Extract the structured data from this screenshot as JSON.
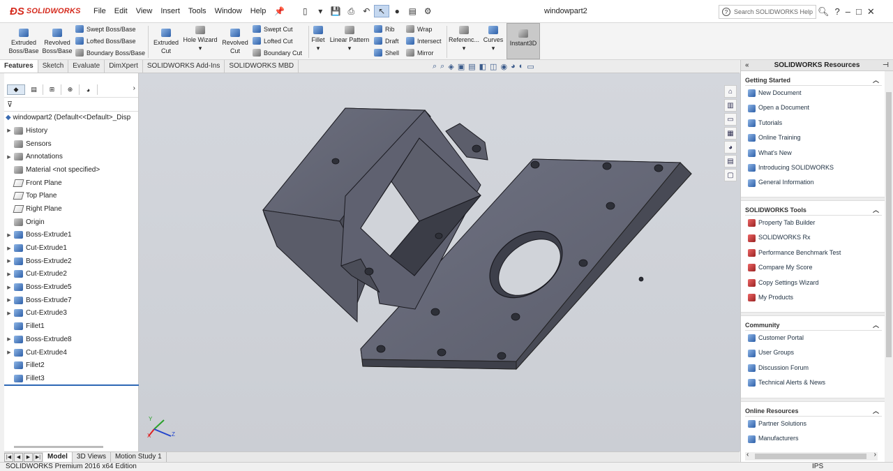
{
  "app": {
    "brand": "SOLIDWORKS",
    "doc_title": "windowpart2"
  },
  "menu": [
    "File",
    "Edit",
    "View",
    "Insert",
    "Tools",
    "Window",
    "Help"
  ],
  "help_search": {
    "placeholder": "Search SOLIDWORKS Help"
  },
  "commands": {
    "extruded_boss": [
      "Extruded",
      "Boss/Base"
    ],
    "revolved_boss": [
      "Revolved",
      "Boss/Base"
    ],
    "swept_boss": "Swept Boss/Base",
    "lofted_boss": "Lofted Boss/Base",
    "boundary_boss": "Boundary Boss/Base",
    "extruded_cut": [
      "Extruded",
      "Cut"
    ],
    "hole_wizard": "Hole Wizard",
    "revolved_cut": [
      "Revolved",
      "Cut"
    ],
    "swept_cut": "Swept Cut",
    "lofted_cut": "Lofted Cut",
    "boundary_cut": "Boundary Cut",
    "fillet": "Fillet",
    "linear_pattern": "Linear Pattern",
    "rib": "Rib",
    "draft": "Draft",
    "shell": "Shell",
    "wrap": "Wrap",
    "intersect": "Intersect",
    "mirror": "Mirror",
    "reference": "Referenc...",
    "curves": "Curves",
    "instant3d": "Instant3D"
  },
  "tabs": [
    "Features",
    "Sketch",
    "Evaluate",
    "DimXpert",
    "SOLIDWORKS Add-Ins",
    "SOLIDWORKS MBD"
  ],
  "tree": {
    "root": "windowpart2  (Default<<Default>_Disp",
    "items": [
      {
        "label": "History",
        "expand": true,
        "icon": "history-icon"
      },
      {
        "label": "Sensors",
        "expand": false,
        "icon": "sensors-icon"
      },
      {
        "label": "Annotations",
        "expand": true,
        "icon": "annotations-icon"
      },
      {
        "label": "Material <not specified>",
        "expand": false,
        "icon": "material-icon"
      },
      {
        "label": "Front Plane",
        "expand": false,
        "icon": "plane-icon"
      },
      {
        "label": "Top Plane",
        "expand": false,
        "icon": "plane-icon"
      },
      {
        "label": "Right Plane",
        "expand": false,
        "icon": "plane-icon"
      },
      {
        "label": "Origin",
        "expand": false,
        "icon": "origin-icon"
      },
      {
        "label": "Boss-Extrude1",
        "expand": true,
        "icon": "boss-extrude-icon"
      },
      {
        "label": "Cut-Extrude1",
        "expand": true,
        "icon": "cut-extrude-icon"
      },
      {
        "label": "Boss-Extrude2",
        "expand": true,
        "icon": "boss-extrude-icon"
      },
      {
        "label": "Cut-Extrude2",
        "expand": true,
        "icon": "cut-extrude-icon"
      },
      {
        "label": "Boss-Extrude5",
        "expand": true,
        "icon": "boss-extrude-icon"
      },
      {
        "label": "Boss-Extrude7",
        "expand": true,
        "icon": "boss-extrude-icon"
      },
      {
        "label": "Cut-Extrude3",
        "expand": true,
        "icon": "cut-extrude-icon"
      },
      {
        "label": "Fillet1",
        "expand": false,
        "icon": "fillet-icon"
      },
      {
        "label": "Boss-Extrude8",
        "expand": true,
        "icon": "boss-extrude-icon"
      },
      {
        "label": "Cut-Extrude4",
        "expand": true,
        "icon": "cut-extrude-icon"
      },
      {
        "label": "Fillet2",
        "expand": false,
        "icon": "fillet-icon"
      },
      {
        "label": "Fillet3",
        "expand": false,
        "icon": "fillet-icon"
      }
    ]
  },
  "taskpane": {
    "title": "SOLIDWORKS Resources",
    "groups": [
      {
        "title": "Getting Started",
        "items": [
          "New Document",
          "Open a Document",
          "Tutorials",
          "Online Training",
          "What's New",
          "Introducing SOLIDWORKS",
          "General Information"
        ]
      },
      {
        "title": "SOLIDWORKS Tools",
        "items": [
          "Property Tab Builder",
          "SOLIDWORKS Rx",
          "Performance Benchmark Test",
          "Compare My Score",
          "Copy Settings Wizard",
          "My Products"
        ]
      },
      {
        "title": "Community",
        "items": [
          "Customer Portal",
          "User Groups",
          "Discussion Forum",
          "Technical Alerts & News"
        ]
      },
      {
        "title": "Online Resources",
        "items": [
          "Partner Solutions",
          "Manufacturers"
        ]
      }
    ]
  },
  "bottom_tabs": [
    "Model",
    "3D Views",
    "Motion Study 1"
  ],
  "status": {
    "edition": "SOLIDWORKS Premium 2016 x64 Edition",
    "units": "IPS"
  },
  "triad": {
    "x": "X",
    "y": "Y",
    "z": "Z"
  },
  "colors": {
    "brand_red": "#d52b1e",
    "model_grey": "#5f6170",
    "viewport_bg": "#d0d3d9",
    "accent_blue": "#2d67b5"
  }
}
